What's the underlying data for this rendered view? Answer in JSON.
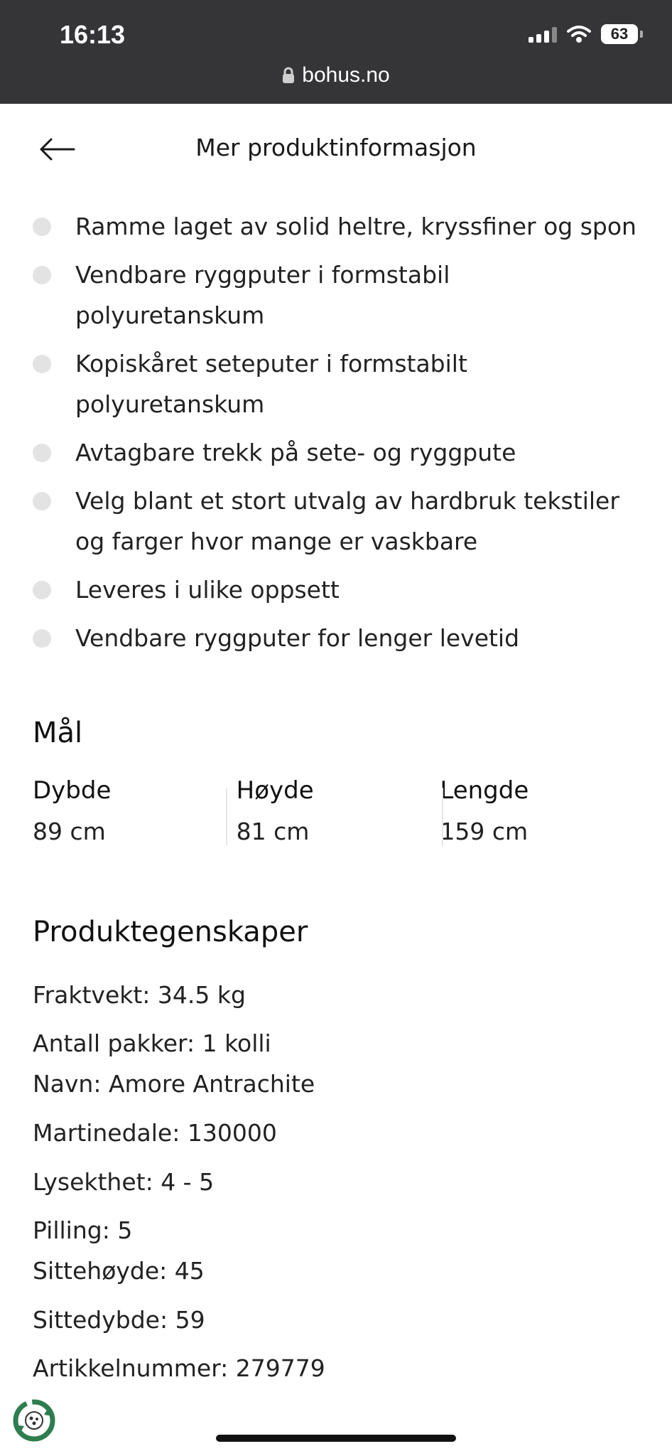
{
  "status_bar": {
    "time": "16:13",
    "battery": "63",
    "url": "bohus.no"
  },
  "header": {
    "title": "Mer produktinformasjon",
    "back_icon": "arrow-left-icon"
  },
  "features": [
    "Ramme laget av solid heltre, kryssfiner og spon",
    "Vendbare ryggputer i formstabil polyuretanskum",
    "Kopiskåret seteputer i formstabilt polyuretanskum",
    "Avtagbare trekk på sete- og ryggpute",
    "Velg blant et stort utvalg av hardbruk tekstiler og farger hvor mange er vaskbare",
    "Leveres i ulike oppsett",
    "Vendbare ryggputer for lenger levetid"
  ],
  "dimensions": {
    "title": "Mål",
    "items": [
      {
        "label": "Dybde",
        "value": "89 cm"
      },
      {
        "label": "Høyde",
        "value": "81 cm"
      },
      {
        "label": "Lengde",
        "value": "159 cm"
      }
    ]
  },
  "properties": {
    "title": "Produktegenskaper",
    "items": [
      "Fraktvekt: 34.5 kg",
      "Antall pakker: 1 kolli",
      "Navn: Amore Antrachite",
      "Martinedale: 130000",
      "Lysekthet: 4 - 5",
      "Pilling: 5",
      "Sittehøyde: 45",
      "Sittedybde: 59",
      "Artikkelnummer: 279779"
    ]
  }
}
